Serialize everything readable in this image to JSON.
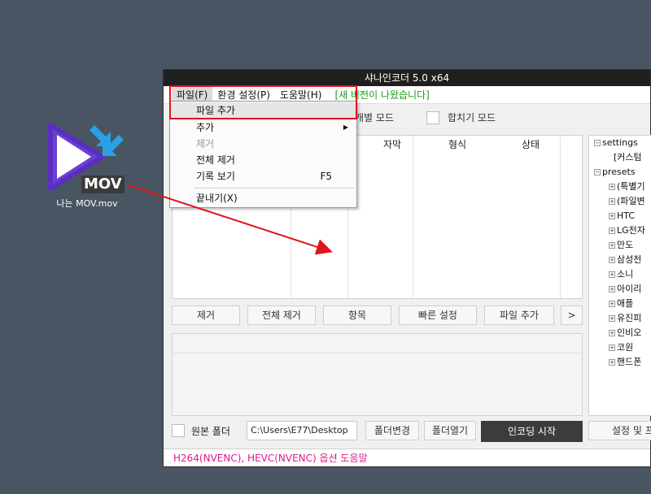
{
  "desktop": {
    "file_label": "나는 MOV.mov",
    "badge": "MOV"
  },
  "window": {
    "title": "샤나인코더 5.0 x64",
    "menu": [
      "파일(F)",
      "환경 설정(P)",
      "도움말(H)"
    ],
    "notice": "[새 버전이 나왔습니다]",
    "modes": [
      "개별 모드",
      "합치기 모드"
    ],
    "columns": [
      "자막",
      "형식",
      "상태"
    ],
    "tree": {
      "settings": "settings",
      "custom": "[커스텀",
      "presets": "presets",
      "items": [
        "(특별기",
        "(파일변",
        "HTC",
        "LG전자",
        "만도",
        "삼성전",
        "소니",
        "아이리",
        "애플",
        "유진피",
        "인비오",
        "코원",
        "핸드폰"
      ]
    },
    "buttons": {
      "remove": "제거",
      "remove_all": "전체 제거",
      "items": "항목",
      "quick": "빠른 설정",
      "add_file": "파일 추가",
      "more": ">"
    },
    "bottom": {
      "source_folder": "원본 폴더",
      "path": "C:\\Users\\E77\\Desktop",
      "change_folder": "폴더변경",
      "open_folder": "폴더열기",
      "encode": "인코딩 시작",
      "settings": "설정 및 프"
    },
    "status": "H264(NVENC), HEVC(NVENC) 옵션 도움말"
  },
  "file_menu": {
    "add_file": "파일 추가",
    "add": "추가",
    "remove": "제거",
    "remove_all": "전체 제거",
    "history": "기록 보기",
    "history_shortcut": "F5",
    "exit": "끝내기(X)"
  },
  "colors": {
    "highlight": "#e0141e",
    "notice": "#1a9a1a",
    "status": "#e0198c"
  }
}
